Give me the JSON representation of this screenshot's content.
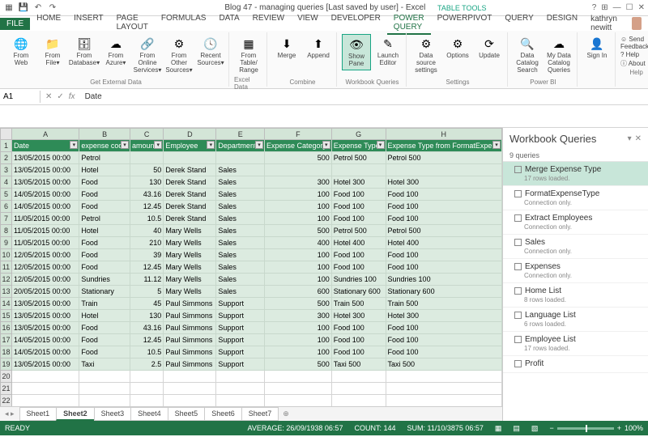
{
  "title": "Blog 47 - managing queries [Last saved by user] - Excel",
  "tabletools": "TABLE TOOLS",
  "user": "kathryn newitt",
  "menu": {
    "file": "FILE",
    "tabs": [
      "HOME",
      "INSERT",
      "PAGE LAYOUT",
      "FORMULAS",
      "DATA",
      "REVIEW",
      "VIEW",
      "DEVELOPER",
      "POWER QUERY",
      "POWERPIVOT",
      "QUERY",
      "DESIGN"
    ],
    "active": "POWER QUERY"
  },
  "ribbon": {
    "g1": {
      "label": "Get External Data",
      "btns": [
        "From Web",
        "From File▾",
        "From Database▾",
        "From Azure▾",
        "From Online Services▾",
        "From Other Sources▾",
        "Recent Sources▾"
      ]
    },
    "g2": {
      "label": "Excel Data",
      "btns": [
        "From Table/ Range"
      ]
    },
    "g3": {
      "label": "Combine",
      "btns": [
        "Merge",
        "Append"
      ]
    },
    "g4": {
      "label": "Workbook Queries",
      "btns": [
        "Show Pane",
        "Launch Editor"
      ]
    },
    "g5": {
      "label": "Settings",
      "btns": [
        "Data source settings",
        "Options",
        "Update"
      ]
    },
    "g6": {
      "label": "Power BI",
      "btns": [
        "Data Catalog Search",
        "My Data Catalog Queries"
      ]
    },
    "g7": {
      "label": "",
      "btns": [
        "Sign In"
      ]
    },
    "g8": {
      "label": "Help",
      "items": [
        "☺ Send Feedback▾",
        "? Help",
        "ⓘ About"
      ]
    }
  },
  "namebox": "A1",
  "formula": "Date",
  "cols": [
    "A",
    "B",
    "C",
    "D",
    "E",
    "F",
    "G",
    "H"
  ],
  "headers": [
    "Date",
    "expense code",
    "amount",
    "Employee",
    "Department",
    "Expense Category",
    "Expense Type",
    "Expense Type from FormatExpens"
  ],
  "rows": [
    [
      "13/05/2015 00:00",
      "Petrol",
      "",
      "",
      "",
      "500",
      "Petrol 500",
      "Petrol 500"
    ],
    [
      "13/05/2015 00:00",
      "Hotel",
      "50",
      "Derek Stand",
      "Sales",
      "",
      "",
      ""
    ],
    [
      "13/05/2015 00:00",
      "Food",
      "130",
      "Derek Stand",
      "Sales",
      "300",
      "Hotel 300",
      "Hotel 300"
    ],
    [
      "14/05/2015 00:00",
      "Food",
      "43.16",
      "Derek Stand",
      "Sales",
      "100",
      "Food 100",
      "Food 100"
    ],
    [
      "14/05/2015 00:00",
      "Food",
      "12.45",
      "Derek Stand",
      "Sales",
      "100",
      "Food 100",
      "Food 100"
    ],
    [
      "11/05/2015 00:00",
      "Petrol",
      "10.5",
      "Derek Stand",
      "Sales",
      "100",
      "Food 100",
      "Food 100"
    ],
    [
      "11/05/2015 00:00",
      "Hotel",
      "40",
      "Mary Wells",
      "Sales",
      "500",
      "Petrol 500",
      "Petrol 500"
    ],
    [
      "11/05/2015 00:00",
      "Food",
      "210",
      "Mary Wells",
      "Sales",
      "400",
      "Hotel 400",
      "Hotel 400"
    ],
    [
      "12/05/2015 00:00",
      "Food",
      "39",
      "Mary Wells",
      "Sales",
      "100",
      "Food 100",
      "Food 100"
    ],
    [
      "12/05/2015 00:00",
      "Food",
      "12.45",
      "Mary Wells",
      "Sales",
      "100",
      "Food 100",
      "Food 100"
    ],
    [
      "12/05/2015 00:00",
      "Sundries",
      "11.12",
      "Mary Wells",
      "Sales",
      "100",
      "Sundries 100",
      "Sundries 100"
    ],
    [
      "20/05/2015 00:00",
      "Stationary",
      "5",
      "Mary Wells",
      "Sales",
      "600",
      "Stationary 600",
      "Stationary 600"
    ],
    [
      "13/05/2015 00:00",
      "Train",
      "45",
      "Paul Simmons",
      "Support",
      "500",
      "Train 500",
      "Train 500"
    ],
    [
      "13/05/2015 00:00",
      "Hotel",
      "130",
      "Paul Simmons",
      "Support",
      "300",
      "Hotel 300",
      "Hotel 300"
    ],
    [
      "13/05/2015 00:00",
      "Food",
      "43.16",
      "Paul Simmons",
      "Support",
      "100",
      "Food 100",
      "Food 100"
    ],
    [
      "14/05/2015 00:00",
      "Food",
      "12.45",
      "Paul Simmons",
      "Support",
      "100",
      "Food 100",
      "Food 100"
    ],
    [
      "14/05/2015 00:00",
      "Food",
      "10.5",
      "Paul Simmons",
      "Support",
      "100",
      "Food 100",
      "Food 100"
    ],
    [
      "13/05/2015 00:00",
      "Taxi",
      "2.5",
      "Paul Simmons",
      "Support",
      "500",
      "Taxi 500",
      "Taxi 500"
    ]
  ],
  "sheets": [
    "Sheet1",
    "Sheet2",
    "Sheet3",
    "Sheet4",
    "Sheet5",
    "Sheet6",
    "Sheet7"
  ],
  "activeSheet": "Sheet2",
  "queries": {
    "title": "Workbook Queries",
    "count": "9 queries",
    "items": [
      {
        "n": "Merge Expense Type",
        "s": "17 rows loaded.",
        "sel": true
      },
      {
        "n": "FormatExpenseType",
        "s": "Connection only."
      },
      {
        "n": "Extract Employees",
        "s": "Connection only."
      },
      {
        "n": "Sales",
        "s": "Connection only."
      },
      {
        "n": "Expenses",
        "s": "Connection only."
      },
      {
        "n": "Home List",
        "s": "8 rows loaded."
      },
      {
        "n": "Language List",
        "s": "6 rows loaded."
      },
      {
        "n": "Employee List",
        "s": "17 rows loaded."
      },
      {
        "n": "Profit",
        "s": ""
      }
    ]
  },
  "status": {
    "ready": "READY",
    "avg": "AVERAGE: 26/09/1938 06:57",
    "count": "COUNT: 144",
    "sum": "SUM: 11/10/3875 06:57",
    "zoom": "100%"
  }
}
